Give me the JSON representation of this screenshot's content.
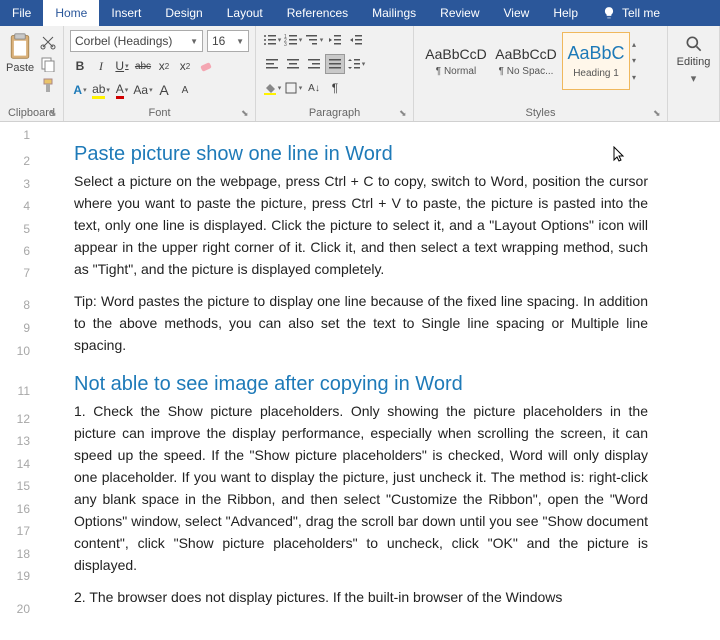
{
  "tabs": {
    "file": "File",
    "home": "Home",
    "insert": "Insert",
    "design": "Design",
    "layout": "Layout",
    "references": "References",
    "mailings": "Mailings",
    "review": "Review",
    "view": "View",
    "help": "Help",
    "tell": "Tell me"
  },
  "clipboard": {
    "paste": "Paste",
    "label": "Clipboard"
  },
  "font": {
    "name": "Corbel (Headings)",
    "size": "16",
    "label": "Font",
    "bold": "B",
    "italic": "I",
    "underline": "U",
    "strike": "abc",
    "x2": "x",
    "x2sup": "2",
    "x2sub": "2",
    "aa": "Aa",
    "a_big": "A",
    "a_small": "A"
  },
  "para": {
    "label": "Paragraph",
    "pilcrow": "¶"
  },
  "styles": {
    "label": "Styles",
    "prev": "AaBbCcD",
    "prev_h": "AaBbC",
    "normal": "¶ Normal",
    "nospace": "¶ No Spac...",
    "heading1": "Heading 1"
  },
  "editing": {
    "label": "Editing"
  },
  "doc": {
    "h1": "Paste picture show one line in Word",
    "p1": "Select a picture on the webpage, press Ctrl + C to copy, switch to Word, position the cursor where you want to paste the picture, press Ctrl + V to paste, the picture is pasted into the text, only one line is displayed. Click the picture to select it, and a \"Layout Options\" icon will appear in the upper right corner of it. Click it, and then select a text wrapping method, such as \"Tight\", and the picture is displayed completely.",
    "p2": "Tip: Word pastes the picture to display one line because of the fixed line spacing. In addition to the above methods, you can also set the text to Single line spacing or Multiple line spacing.",
    "h2": "Not able to see image after copying in Word",
    "p3": "1. Check the Show picture placeholders. Only showing the picture placeholders in the picture can improve the display performance, especially when scrolling the screen, it can speed up the speed. If the \"Show picture placeholders\" is checked, Word will only display one placeholder. If you want to display the picture, just uncheck it. The method is: right-click any blank space in the Ribbon, and then select \"Customize the Ribbon\", open the \"Word Options\" window, select \"Advanced\", drag the scroll bar down until you see \"Show document content\", click \"Show picture placeholders\" to uncheck, click \"OK\" and the picture is displayed.",
    "p4": "2. The browser does not display pictures. If the built-in browser of the Windows"
  },
  "lines": [
    "1",
    "2",
    "3",
    "4",
    "5",
    "6",
    "7",
    "8",
    "9",
    "10",
    "11",
    "12",
    "13",
    "14",
    "15",
    "16",
    "17",
    "18",
    "19",
    "20"
  ]
}
